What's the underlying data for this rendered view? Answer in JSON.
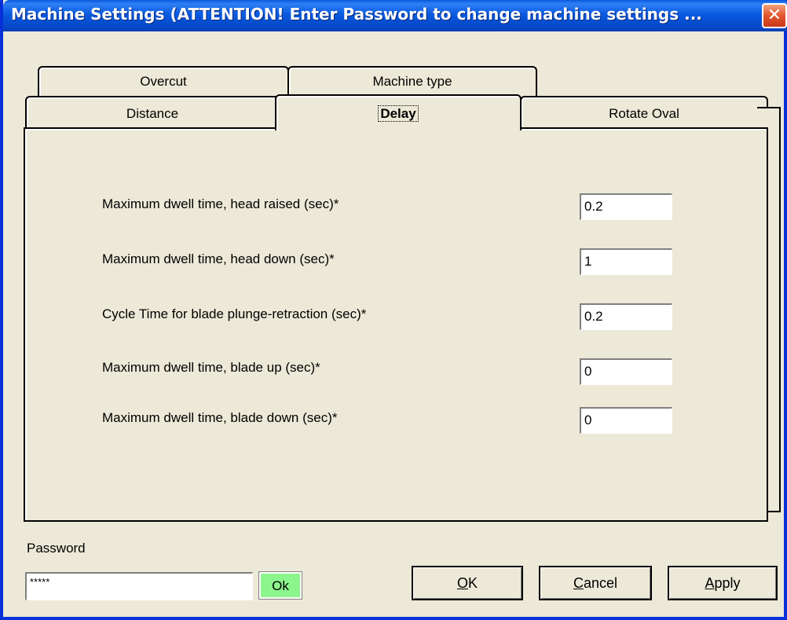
{
  "window": {
    "title": "Machine Settings (ATTENTION! Enter Password to change machine settings ...",
    "close_glyph": "✕"
  },
  "tabs": {
    "row_back": [
      "Overcut",
      "Machine type"
    ],
    "row_front": [
      "Distance",
      "Delay",
      "Rotate Oval"
    ],
    "active": "Delay"
  },
  "delay": {
    "fields": [
      {
        "label": "Maximum dwell time, head raised (sec)*",
        "value": "0.2"
      },
      {
        "label": "Maximum dwell time, head down (sec)*",
        "value": "1"
      },
      {
        "label": "Cycle Time for blade plunge-retraction (sec)*",
        "value": "0.2"
      },
      {
        "label": "Maximum dwell time, blade up (sec)*",
        "value": "0"
      },
      {
        "label": "Maximum dwell time, blade down (sec)*",
        "value": "0"
      }
    ]
  },
  "password": {
    "label": "Password",
    "value": "*****",
    "ok_label": "Ok"
  },
  "buttons": {
    "ok_mnemonic": "O",
    "ok_rest": "K",
    "cancel_mnemonic": "C",
    "cancel_rest": "ancel",
    "apply_mnemonic": "A",
    "apply_rest": "pply"
  },
  "colors": {
    "titlebar": "#0a5ae0",
    "face": "#ece9d8",
    "close": "#e2552b",
    "ok_button": "#8cf58c"
  }
}
